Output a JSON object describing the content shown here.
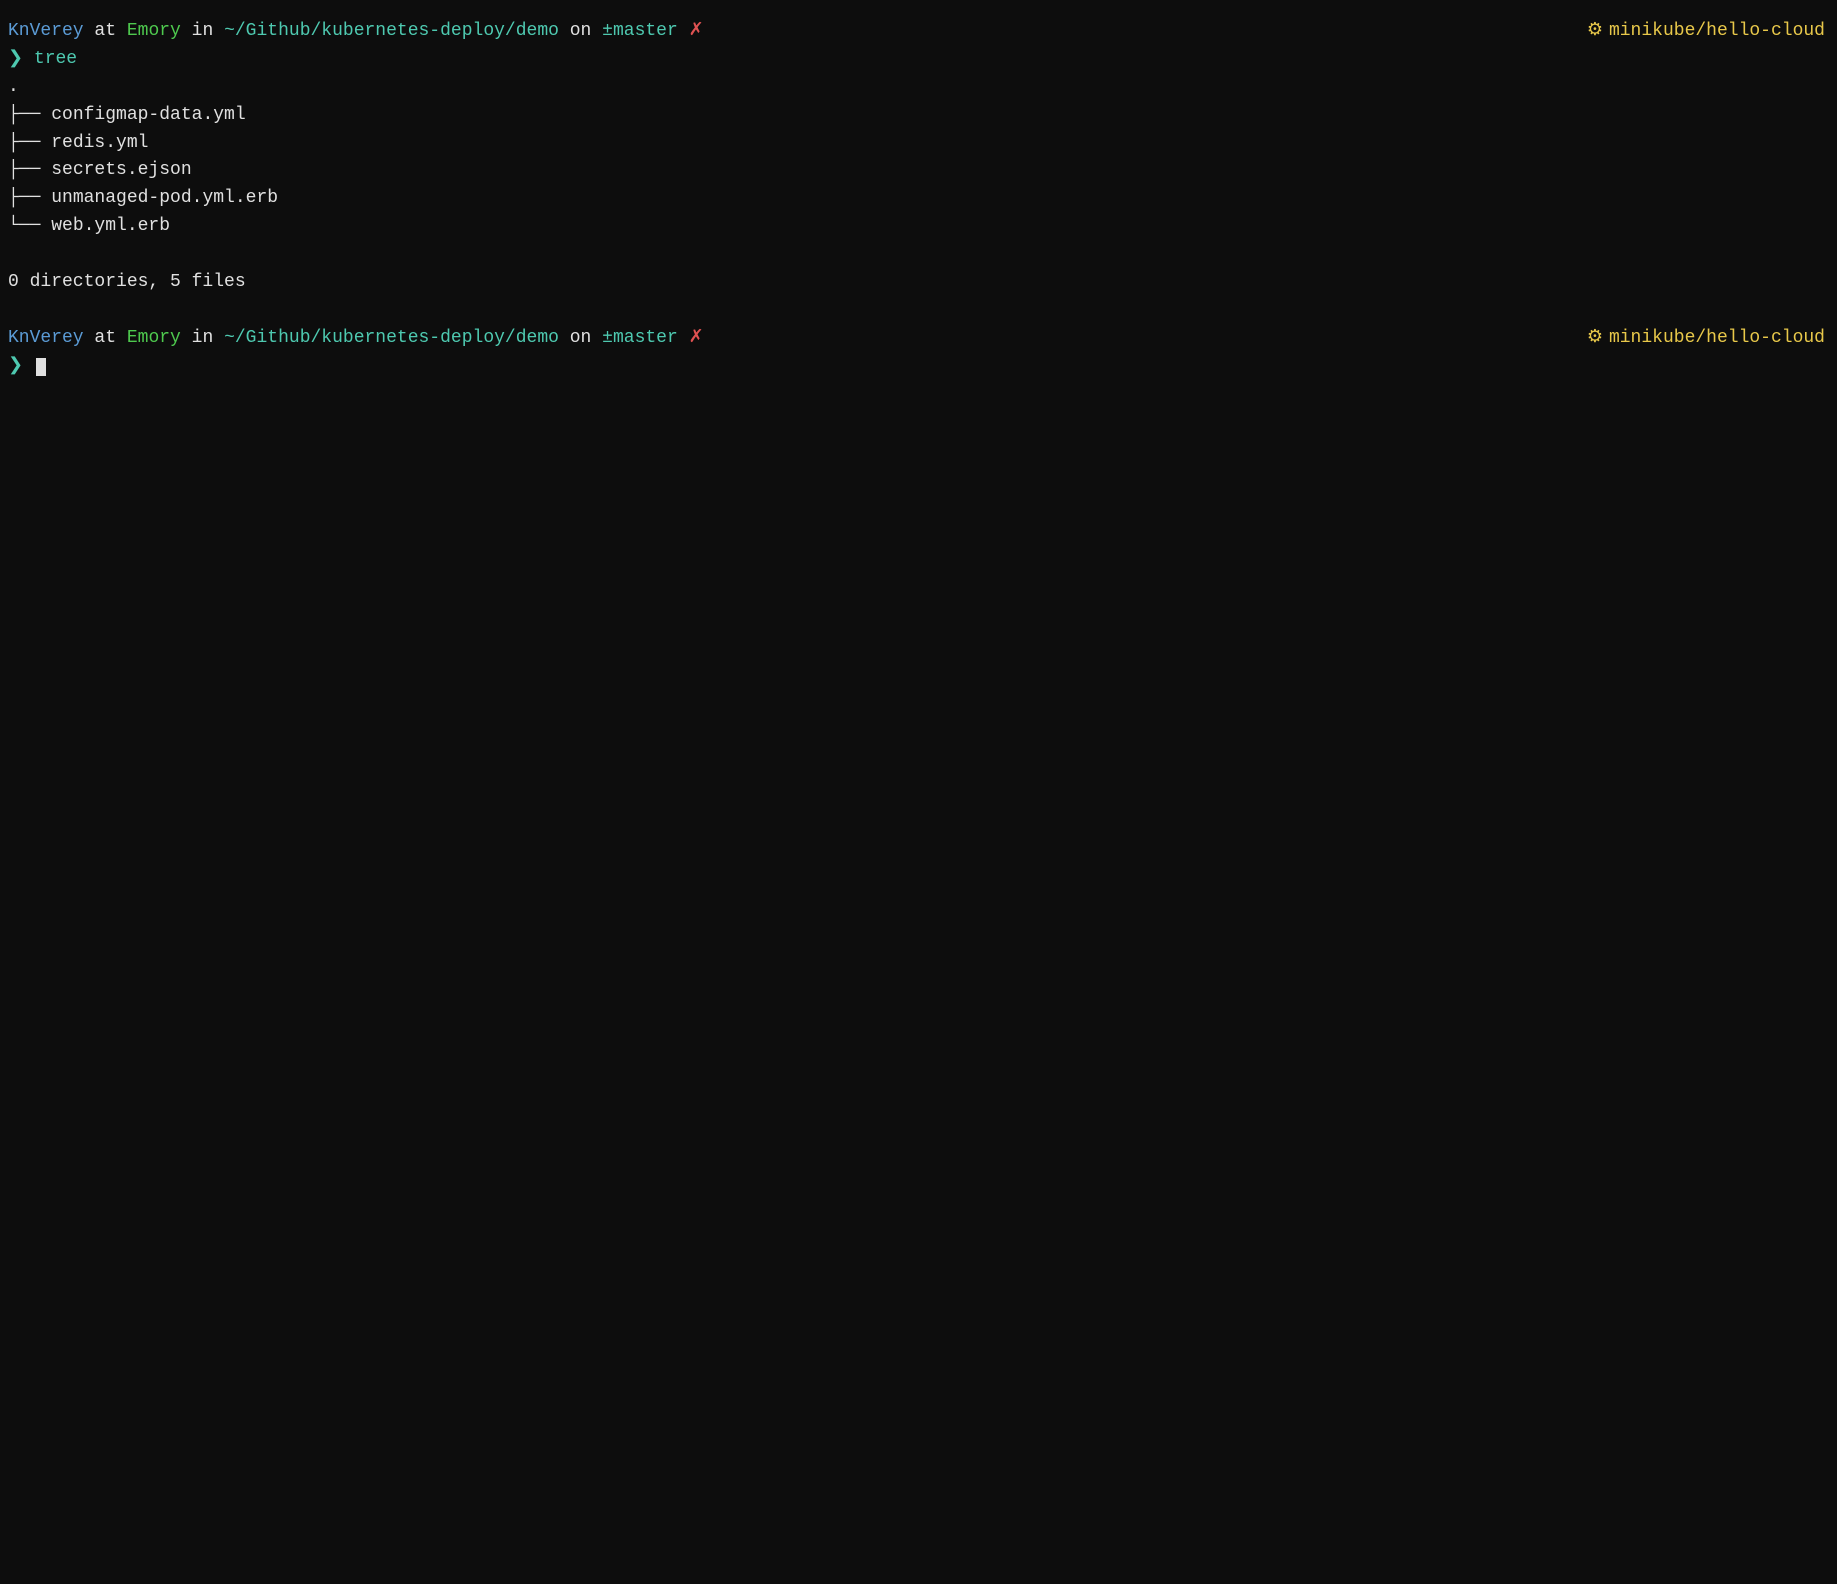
{
  "terminal": {
    "prompt1": {
      "user": "KnVerey",
      "at": " at ",
      "host": "Emory",
      "in": " in ",
      "path": "~/Github/kubernetes-deploy/demo",
      "on": " on ",
      "branch_symbol": "±",
      "branch": "master",
      "x": "✗",
      "prompt_symbol": "❯",
      "command": "tree"
    },
    "right1": {
      "gear": "⚙",
      "context": "minikube/hello-cloud"
    },
    "tree_root": ".",
    "files": [
      "configmap-data.yml",
      "redis.yml",
      "secrets.ejson",
      "unmanaged-pod.yml.erb",
      "web.yml.erb"
    ],
    "summary": "0 directories, 5 files",
    "prompt2": {
      "user": "KnVerey",
      "at": " at ",
      "host": "Emory",
      "in": " in ",
      "path": "~/Github/kubernetes-deploy/demo",
      "on": " on ",
      "branch_symbol": "±",
      "branch": "master",
      "x": "✗",
      "prompt_symbol": "❯"
    },
    "right2": {
      "gear": "⚙",
      "context": "minikube/hello-cloud"
    }
  }
}
